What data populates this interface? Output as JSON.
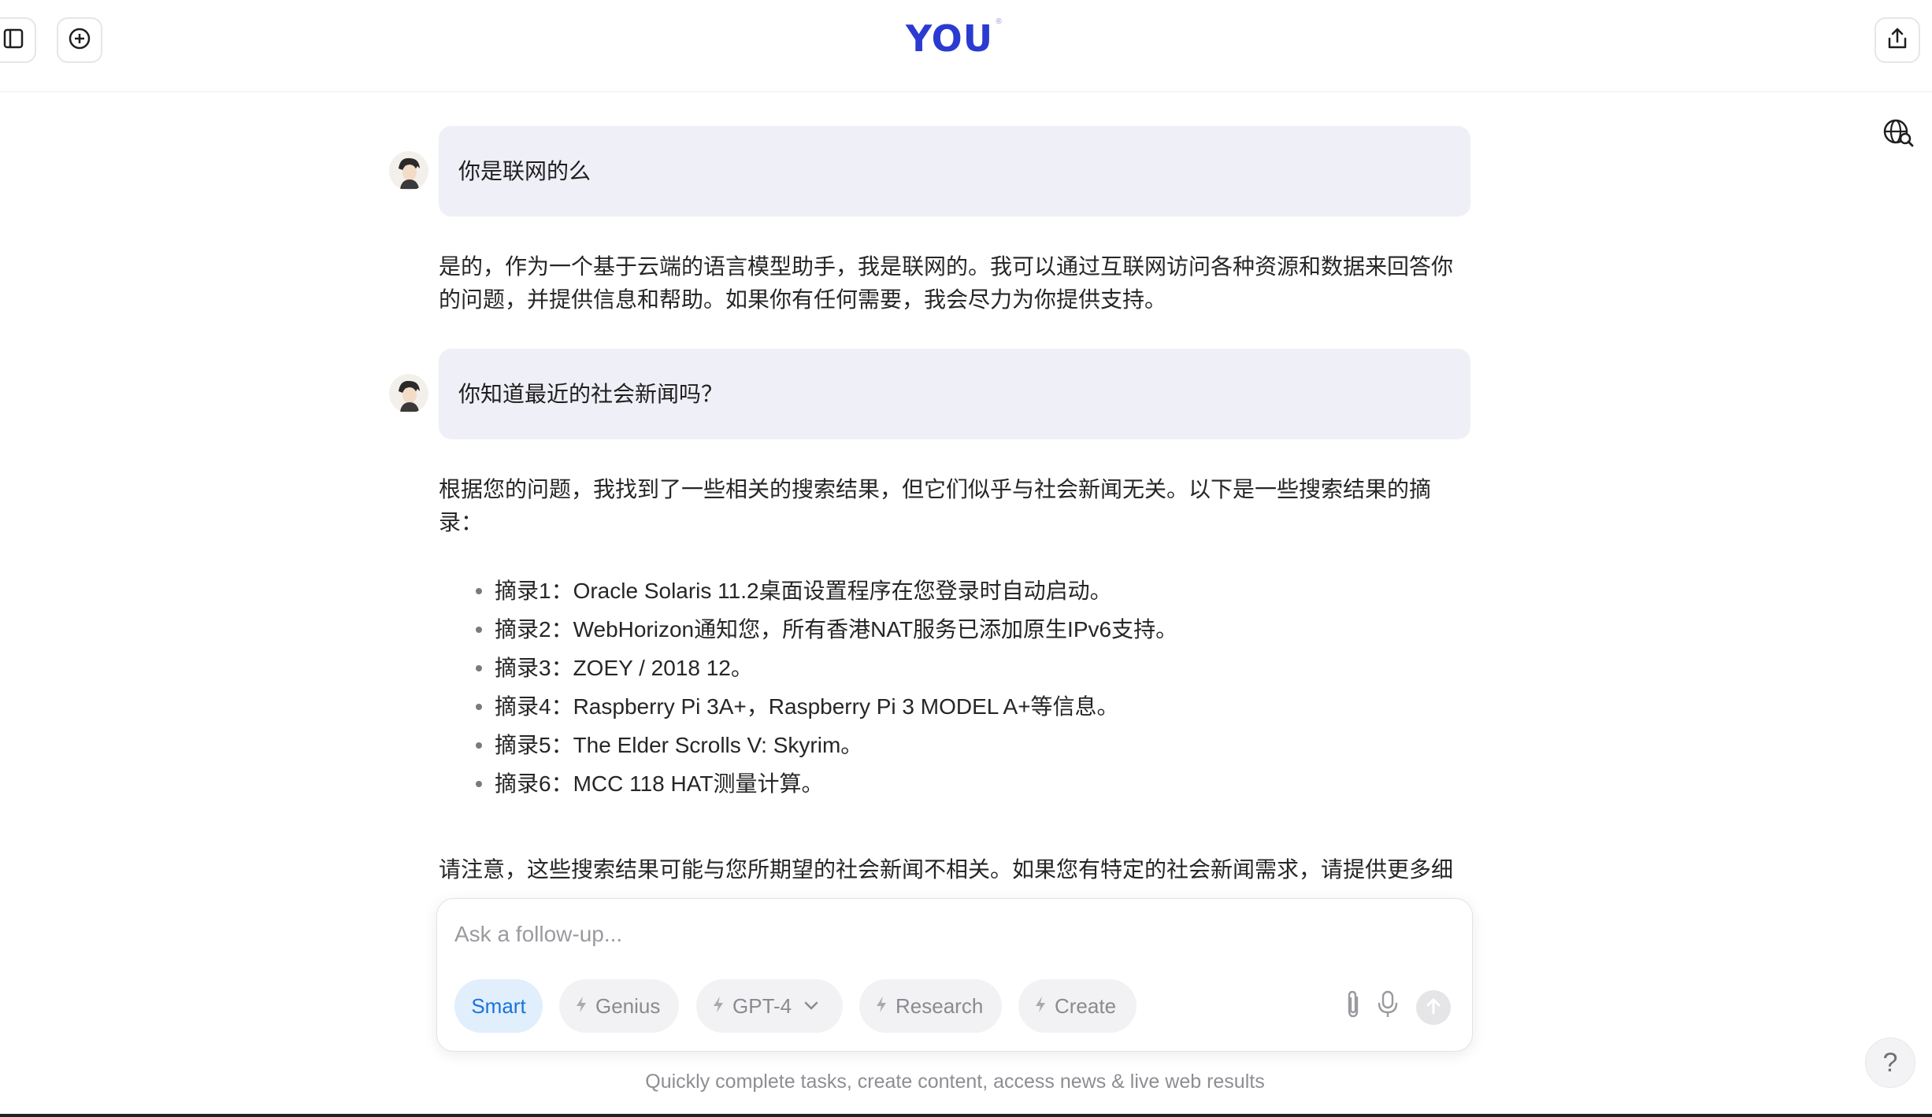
{
  "header": {
    "logo": "YOU",
    "logo_mark": "®"
  },
  "messages": [
    {
      "role": "user",
      "text": "你是联网的么"
    },
    {
      "role": "assistant",
      "text": "是的，作为一个基于云端的语言模型助手，我是联网的。我可以通过互联网访问各种资源和数据来回答你的问题，并提供信息和帮助。如果你有任何需要，我会尽力为你提供支持。"
    },
    {
      "role": "user",
      "text": "你知道最近的社会新闻吗？"
    },
    {
      "role": "assistant",
      "intro": "根据您的问题，我找到了一些相关的搜索结果，但它们似乎与社会新闻无关。以下是一些搜索结果的摘录：",
      "bullets": [
        "摘录1：Oracle Solaris 11.2桌面设置程序在您登录时自动启动。",
        "摘录2：WebHorizon通知您，所有香港NAT服务已添加原生IPv6支持。",
        "摘录3：ZOEY / 2018 12。",
        "摘录4：Raspberry Pi 3A+，Raspberry Pi 3 MODEL A+等信息。",
        "摘录5：The Elder Scrolls V: Skyrim。",
        "摘录6：MCC 118 HAT测量计算。"
      ],
      "outro": "请注意，这些搜索结果可能与您所期望的社会新闻不相关。如果您有特定的社会新闻需求，请提供更多细"
    }
  ],
  "composer": {
    "placeholder": "Ask a follow-up...",
    "modes": {
      "smart": "Smart",
      "genius": "Genius",
      "gpt4": "GPT-4",
      "research": "Research",
      "create": "Create"
    }
  },
  "footer": {
    "note": "Quickly complete tasks, create content, access news & live web results",
    "help": "?"
  },
  "colors": {
    "brand": "#2b3bd1",
    "active_mode_bg": "#e1eefc",
    "active_mode_text": "#1a73d9",
    "user_bubble": "#efeff7"
  },
  "icons": [
    "sidebar-toggle-icon",
    "new-chat-icon",
    "share-icon",
    "globe-search-icon",
    "bolt-icon",
    "chevron-down-icon",
    "paperclip-icon",
    "mic-icon",
    "arrow-up-icon",
    "help-icon"
  ]
}
